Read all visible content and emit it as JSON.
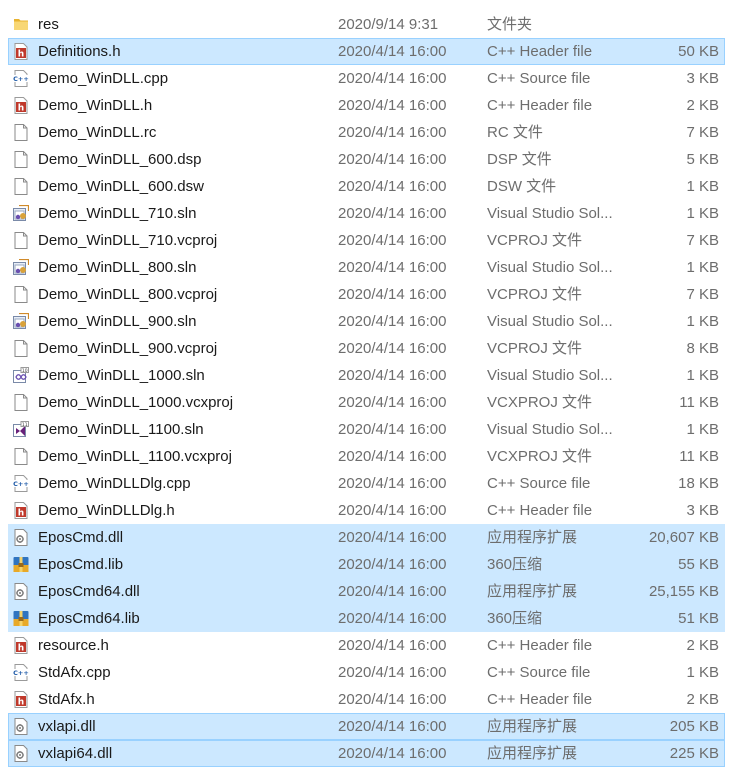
{
  "files": [
    {
      "name": "res",
      "date": "2020/9/14 9:31",
      "type": "文件夹",
      "size": "",
      "icon": "folder-icon",
      "selected": false
    },
    {
      "name": "Definitions.h",
      "date": "2020/4/14 16:00",
      "type": "C++ Header file",
      "size": "50 KB",
      "icon": "header-file-icon",
      "selected": true
    },
    {
      "name": "Demo_WinDLL.cpp",
      "date": "2020/4/14 16:00",
      "type": "C++ Source file",
      "size": "3 KB",
      "icon": "cpp-file-icon",
      "selected": false
    },
    {
      "name": "Demo_WinDLL.h",
      "date": "2020/4/14 16:00",
      "type": "C++ Header file",
      "size": "2 KB",
      "icon": "header-file-icon",
      "selected": false
    },
    {
      "name": "Demo_WinDLL.rc",
      "date": "2020/4/14 16:00",
      "type": "RC 文件",
      "size": "7 KB",
      "icon": "blank-file-icon",
      "selected": false
    },
    {
      "name": "Demo_WinDLL_600.dsp",
      "date": "2020/4/14 16:00",
      "type": "DSP 文件",
      "size": "5 KB",
      "icon": "blank-file-icon",
      "selected": false
    },
    {
      "name": "Demo_WinDLL_600.dsw",
      "date": "2020/4/14 16:00",
      "type": "DSW 文件",
      "size": "1 KB",
      "icon": "blank-file-icon",
      "selected": false
    },
    {
      "name": "Demo_WinDLL_710.sln",
      "date": "2020/4/14 16:00",
      "type": "Visual Studio Sol...",
      "size": "1 KB",
      "icon": "vs-solution-icon",
      "selected": false
    },
    {
      "name": "Demo_WinDLL_710.vcproj",
      "date": "2020/4/14 16:00",
      "type": "VCPROJ 文件",
      "size": "7 KB",
      "icon": "blank-file-icon",
      "selected": false
    },
    {
      "name": "Demo_WinDLL_800.sln",
      "date": "2020/4/14 16:00",
      "type": "Visual Studio Sol...",
      "size": "1 KB",
      "icon": "vs-solution-icon",
      "selected": false
    },
    {
      "name": "Demo_WinDLL_800.vcproj",
      "date": "2020/4/14 16:00",
      "type": "VCPROJ 文件",
      "size": "7 KB",
      "icon": "blank-file-icon",
      "selected": false
    },
    {
      "name": "Demo_WinDLL_900.sln",
      "date": "2020/4/14 16:00",
      "type": "Visual Studio Sol...",
      "size": "1 KB",
      "icon": "vs-solution-icon",
      "selected": false
    },
    {
      "name": "Demo_WinDLL_900.vcproj",
      "date": "2020/4/14 16:00",
      "type": "VCPROJ 文件",
      "size": "8 KB",
      "icon": "blank-file-icon",
      "selected": false
    },
    {
      "name": "Demo_WinDLL_1000.sln",
      "date": "2020/4/14 16:00",
      "type": "Visual Studio Sol...",
      "size": "1 KB",
      "icon": "vs-solution-10-icon",
      "selected": false
    },
    {
      "name": "Demo_WinDLL_1000.vcxproj",
      "date": "2020/4/14 16:00",
      "type": "VCXPROJ 文件",
      "size": "11 KB",
      "icon": "blank-file-icon",
      "selected": false
    },
    {
      "name": "Demo_WinDLL_1100.sln",
      "date": "2020/4/14 16:00",
      "type": "Visual Studio Sol...",
      "size": "1 KB",
      "icon": "vs-solution-11-icon",
      "selected": false
    },
    {
      "name": "Demo_WinDLL_1100.vcxproj",
      "date": "2020/4/14 16:00",
      "type": "VCXPROJ 文件",
      "size": "11 KB",
      "icon": "blank-file-icon",
      "selected": false
    },
    {
      "name": "Demo_WinDLLDlg.cpp",
      "date": "2020/4/14 16:00",
      "type": "C++ Source file",
      "size": "18 KB",
      "icon": "cpp-file-icon",
      "selected": false
    },
    {
      "name": "Demo_WinDLLDlg.h",
      "date": "2020/4/14 16:00",
      "type": "C++ Header file",
      "size": "3 KB",
      "icon": "header-file-icon",
      "selected": false
    },
    {
      "name": "EposCmd.dll",
      "date": "2020/4/14 16:00",
      "type": "应用程序扩展",
      "size": "20,607 KB",
      "icon": "dll-file-icon",
      "selected": true
    },
    {
      "name": "EposCmd.lib",
      "date": "2020/4/14 16:00",
      "type": "360压缩",
      "size": "55 KB",
      "icon": "archive-icon",
      "selected": true
    },
    {
      "name": "EposCmd64.dll",
      "date": "2020/4/14 16:00",
      "type": "应用程序扩展",
      "size": "25,155 KB",
      "icon": "dll-file-icon",
      "selected": true
    },
    {
      "name": "EposCmd64.lib",
      "date": "2020/4/14 16:00",
      "type": "360压缩",
      "size": "51 KB",
      "icon": "archive-icon",
      "selected": true
    },
    {
      "name": "resource.h",
      "date": "2020/4/14 16:00",
      "type": "C++ Header file",
      "size": "2 KB",
      "icon": "header-file-icon",
      "selected": false
    },
    {
      "name": "StdAfx.cpp",
      "date": "2020/4/14 16:00",
      "type": "C++ Source file",
      "size": "1 KB",
      "icon": "cpp-file-icon",
      "selected": false
    },
    {
      "name": "StdAfx.h",
      "date": "2020/4/14 16:00",
      "type": "C++ Header file",
      "size": "2 KB",
      "icon": "header-file-icon",
      "selected": false
    },
    {
      "name": "vxlapi.dll",
      "date": "2020/4/14 16:00",
      "type": "应用程序扩展",
      "size": "205 KB",
      "icon": "dll-file-icon",
      "selected": true
    },
    {
      "name": "vxlapi64.dll",
      "date": "2020/4/14 16:00",
      "type": "应用程序扩展",
      "size": "225 KB",
      "icon": "dll-file-icon",
      "selected": true
    }
  ],
  "colors": {
    "selection_bg": "#cce8ff",
    "selection_border": "#99d1ff",
    "secondary_text": "#6d6d6d",
    "header_icon_red": "#c0392b",
    "cpp_icon_blue": "#1e5aa8",
    "folder_yellow": "#f4c542"
  }
}
